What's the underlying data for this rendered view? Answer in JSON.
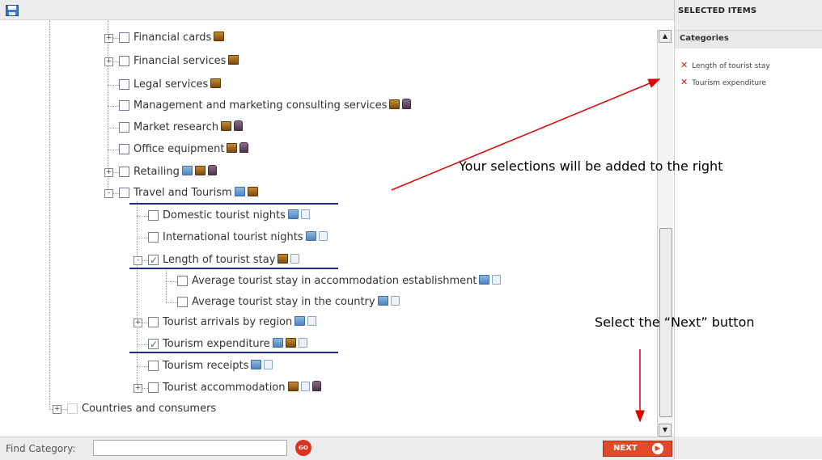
{
  "toolbar": {
    "save_icon": "save-disk-icon"
  },
  "tree": {
    "nodes": [
      {
        "label": "Financial cards",
        "expander": "+",
        "checked": false,
        "icons": [
          "box"
        ]
      },
      {
        "label": "Financial services",
        "expander": "+",
        "checked": false,
        "icons": [
          "box"
        ]
      },
      {
        "label": "Legal services",
        "expander": "",
        "checked": false,
        "icons": [
          "box"
        ]
      },
      {
        "label": "Management and marketing consulting services",
        "expander": "",
        "checked": false,
        "icons": [
          "box",
          "bag"
        ]
      },
      {
        "label": "Market research",
        "expander": "",
        "checked": false,
        "icons": [
          "box",
          "bag"
        ]
      },
      {
        "label": "Office equipment",
        "expander": "",
        "checked": false,
        "icons": [
          "box",
          "bag"
        ]
      },
      {
        "label": "Retailing",
        "expander": "+",
        "checked": false,
        "icons": [
          "table",
          "box",
          "bag"
        ]
      },
      {
        "label": "Travel and Tourism",
        "expander": "-",
        "checked": false,
        "icons": [
          "table",
          "box"
        ]
      },
      {
        "label": "Domestic tourist nights",
        "expander": "",
        "checked": false,
        "icons": [
          "table",
          "doc"
        ]
      },
      {
        "label": "International tourist nights",
        "expander": "",
        "checked": false,
        "icons": [
          "table",
          "doc"
        ]
      },
      {
        "label": "Length of tourist stay",
        "expander": "-",
        "checked": true,
        "icons": [
          "box",
          "doc"
        ]
      },
      {
        "label": "Average tourist stay in accommodation establishment",
        "expander": "",
        "checked": false,
        "icons": [
          "table",
          "doc"
        ]
      },
      {
        "label": "Average tourist stay in the country",
        "expander": "",
        "checked": false,
        "icons": [
          "table",
          "doc"
        ]
      },
      {
        "label": "Tourist arrivals by region",
        "expander": "+",
        "checked": false,
        "icons": [
          "table",
          "doc"
        ]
      },
      {
        "label": "Tourism expenditure",
        "expander": "",
        "checked": true,
        "icons": [
          "table",
          "box",
          "doc"
        ]
      },
      {
        "label": "Tourism receipts",
        "expander": "",
        "checked": false,
        "icons": [
          "table",
          "doc"
        ]
      },
      {
        "label": "Tourist accommodation",
        "expander": "+",
        "checked": false,
        "icons": [
          "box",
          "doc",
          "bag"
        ]
      },
      {
        "label": "Countries and consumers",
        "expander": "+",
        "checked": false,
        "icons": []
      }
    ]
  },
  "right_panel": {
    "header": "SELECTED ITEMS",
    "category_label": "Categories",
    "items": [
      "Length of tourist stay",
      "Tourism expenditure"
    ]
  },
  "bottom": {
    "find_label": "Find Category:",
    "find_value": "",
    "go_label": "GO",
    "next_label": "NEXT",
    "next_arrow": "▶"
  },
  "annotations": {
    "selections_note": "Your selections will be added to the right",
    "next_note": "Select the “Next” button"
  },
  "colors": {
    "accent": "#e14a28",
    "remove": "#c52323",
    "underline": "#1c2d8f",
    "arrow": "#e00000"
  }
}
